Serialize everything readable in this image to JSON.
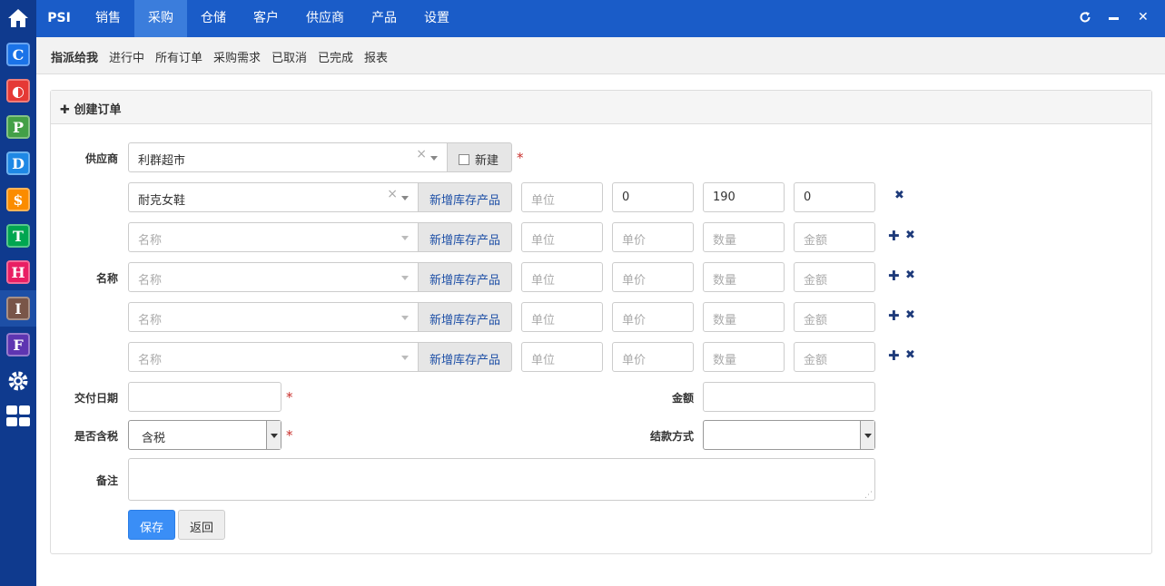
{
  "nav": {
    "brand": "PSI",
    "items": [
      "销售",
      "采购",
      "仓储",
      "客户",
      "供应商",
      "产品",
      "设置"
    ],
    "active": "采购"
  },
  "subnav": [
    "指派给我",
    "进行中",
    "所有订单",
    "采购需求",
    "已取消",
    "已完成",
    "报表"
  ],
  "sidebar": [
    {
      "letter": "C",
      "color": "#1a73e8"
    },
    {
      "letter": "◐",
      "color": "#e53935"
    },
    {
      "letter": "P",
      "color": "#43a047"
    },
    {
      "letter": "D",
      "color": "#1e88e5"
    },
    {
      "letter": "$",
      "color": "#fb8c00"
    },
    {
      "letter": "T",
      "color": "#00a651"
    },
    {
      "letter": "H",
      "color": "#e91e63"
    },
    {
      "letter": "I",
      "color": "#795548"
    },
    {
      "letter": "F",
      "color": "#5e35b1"
    }
  ],
  "panel": {
    "title": "创建订单"
  },
  "form": {
    "supplier_label": "供应商",
    "supplier_value": "利群超市",
    "new_label": "新建",
    "name_label": "名称",
    "add_product": "新增库存产品",
    "first_row": {
      "product": "耐克女鞋",
      "unit_ph": "单位",
      "price": "0",
      "qty": "190",
      "amount": "0"
    },
    "row_placeholders": {
      "name": "名称",
      "unit": "单位",
      "price": "单价",
      "qty": "数量",
      "amount": "金额"
    },
    "delivery_label": "交付日期",
    "amount_label": "金额",
    "tax_label": "是否含税",
    "tax_value": "含税",
    "payment_label": "结款方式",
    "remark_label": "备注",
    "save": "保存",
    "back": "返回"
  }
}
